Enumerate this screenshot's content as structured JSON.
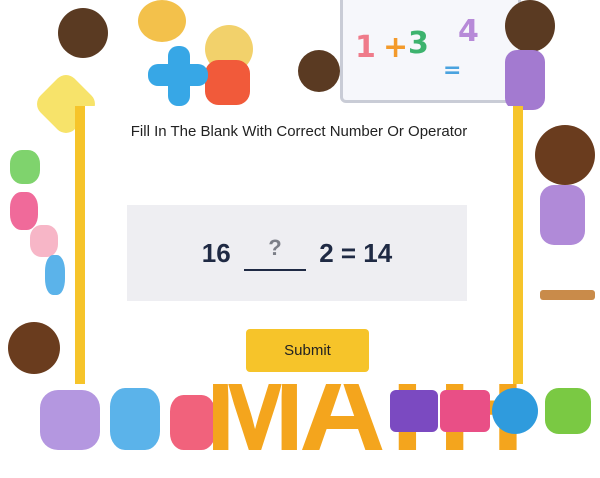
{
  "question": {
    "text": "Fill In The Blank With Correct Number Or Operator"
  },
  "equation": {
    "left": "16",
    "blank": "?",
    "right": "2 = 14"
  },
  "submit": {
    "label": "Submit"
  },
  "decor": {
    "whiteboard_glyphs": [
      "1",
      "+",
      "3",
      "4",
      "="
    ],
    "bottom_word": "MATH"
  },
  "colors": {
    "accent": "#f6c42a",
    "equation_text": "#1f2a44",
    "equation_bg": "#eeeef2"
  }
}
